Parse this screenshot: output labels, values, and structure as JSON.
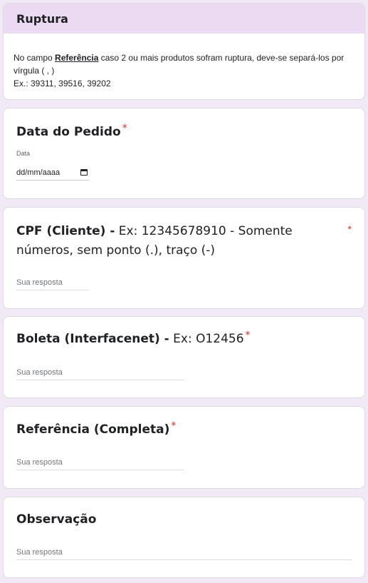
{
  "section": {
    "title": "Ruptura",
    "description_line1_pre": "No campo ",
    "description_ref": "Referência",
    "description_line1_post": " caso 2 ou mais produtos sofram ruptura, deve-se separá-los por vírgula ( , )",
    "description_example": "Ex.:  39311, 39516, 39202"
  },
  "questions": [
    {
      "title_bold": "Data do Pedido",
      "title_rest": "",
      "required": "*",
      "sub_label": "Data",
      "value": "dd/mm/aaaa",
      "icon": "calendar-icon"
    },
    {
      "title_bold": "CPF (Cliente) -",
      "title_rest": " Ex: 12345678910 - Somente números, sem ponto (.), traço (-)",
      "required": "*",
      "placeholder": "Sua resposta"
    },
    {
      "title_bold": "Boleta (Interfacenet) -",
      "title_rest": " Ex: O12456",
      "required": "*",
      "placeholder": "Sua resposta"
    },
    {
      "title_bold": "Referência (Completa)",
      "title_rest": "",
      "required": "*",
      "placeholder": "Sua resposta"
    },
    {
      "title_bold": "Observação",
      "title_rest": "",
      "required": "",
      "placeholder": "Sua resposta"
    }
  ],
  "colors": {
    "header_bg": "#ebdaf2",
    "page_bg": "#f1e9f6",
    "required": "#d93025"
  }
}
